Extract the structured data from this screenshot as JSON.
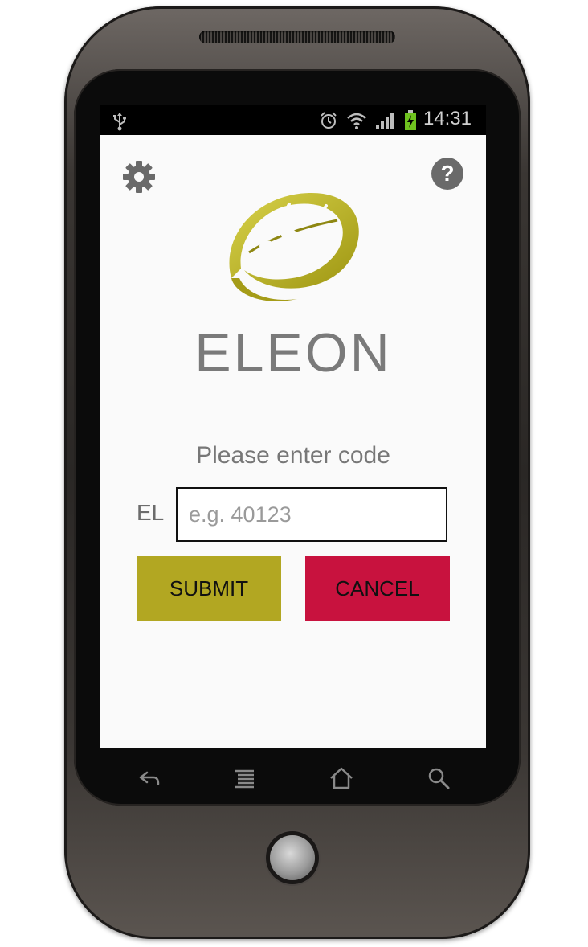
{
  "status_bar": {
    "time": "14:31",
    "icons": [
      "usb-icon",
      "alarm-icon",
      "wifi-icon",
      "signal-icon",
      "battery-charging-icon"
    ]
  },
  "app": {
    "brand_name": "ELEON",
    "prompt": "Please enter code",
    "code_prefix": "EL",
    "code_input": {
      "value": "",
      "placeholder": "e.g. 40123"
    },
    "submit_label": "SUBMIT",
    "cancel_label": "CANCEL",
    "top_icons": {
      "left": "settings-gear-icon",
      "right": "help-icon"
    },
    "help_glyph": "?",
    "colors": {
      "submit": "#b2a722",
      "cancel": "#c8123e",
      "logo": "#b8b021",
      "brand_text": "#7a7a7a",
      "background": "#fafafa"
    }
  },
  "nav_bar": {
    "icons": [
      "back-icon",
      "menu-icon",
      "home-icon",
      "search-icon"
    ]
  }
}
